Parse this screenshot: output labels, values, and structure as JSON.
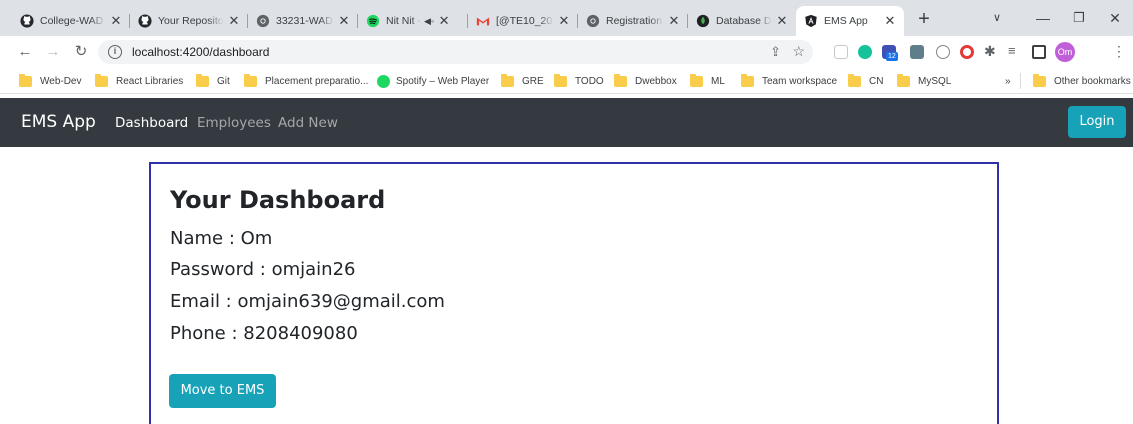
{
  "browser": {
    "tabs": [
      {
        "title": "College-WAD",
        "icon": "github-icon"
      },
      {
        "title": "Your Repositories",
        "icon": "github-icon"
      },
      {
        "title": "33231-WAD",
        "icon": "chrome-icon"
      },
      {
        "title": "Nit Nit -",
        "icon": "spotify-icon"
      },
      {
        "title": "[@TE10_201",
        "icon": "gmail-icon"
      },
      {
        "title": "Registration",
        "icon": "chrome-icon"
      },
      {
        "title": "Database De",
        "icon": "mongodb-icon"
      },
      {
        "title": "EMS App",
        "icon": "angular-icon"
      }
    ],
    "url": "localhost:4200/dashboard",
    "profile_initials": "Om",
    "extension_badge": "12",
    "bookmarks": [
      "Web-Dev",
      "React Libraries",
      "Git",
      "Placement preparatio...",
      "Spotify – Web Player",
      "GRE",
      "TODO",
      "Dwebbox",
      "ML",
      "Team workspace",
      "CN",
      "MySQL"
    ],
    "overflow_label": "»",
    "other_bookmarks": "Other bookmarks"
  },
  "app": {
    "brand": "EMS App",
    "nav": {
      "dashboard": "Dashboard",
      "employees": "Employees",
      "add_new": "Add New"
    },
    "login_label": "Login"
  },
  "dashboard": {
    "title": "Your Dashboard",
    "name": "Name : Om",
    "password": "Password : omjain26",
    "email": "Email : omjain639@gmail.com",
    "phone": "Phone : 8208409080",
    "button_label": "Move to EMS"
  },
  "colors": {
    "navbar": "#343a40",
    "accent": "#17a2b8",
    "card_border": "#2f2fa8"
  }
}
